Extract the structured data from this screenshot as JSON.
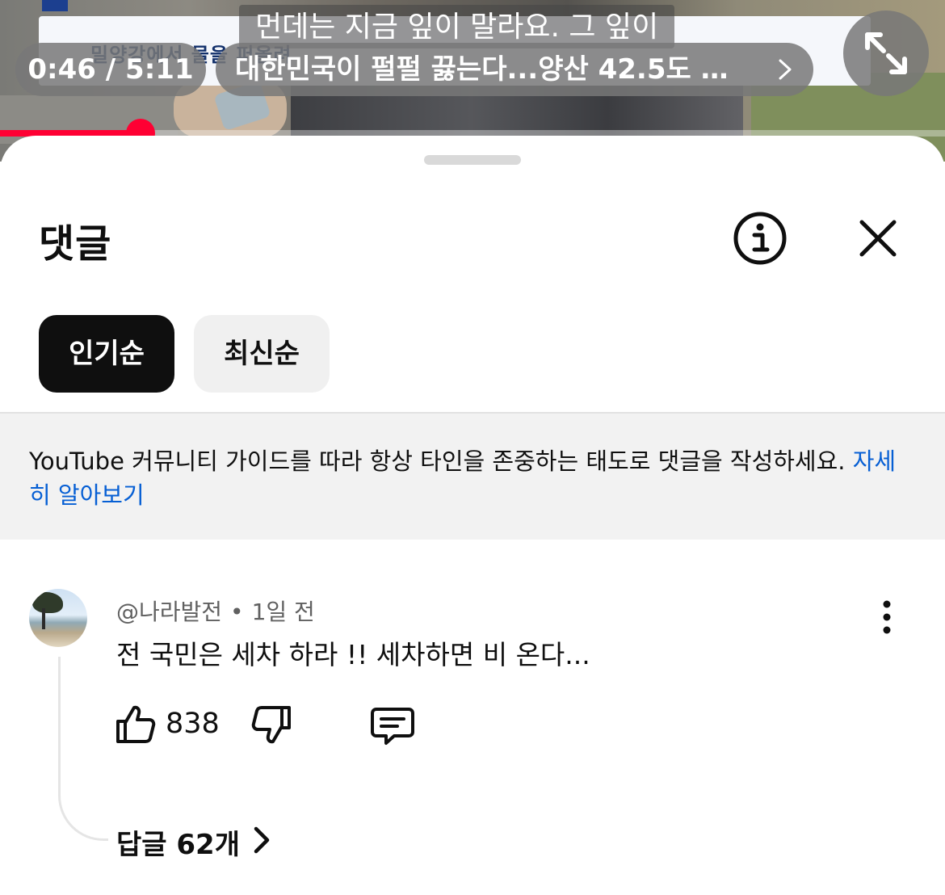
{
  "video": {
    "news_tag": "",
    "news_headline": "밀양강에서 물을 퍼올려",
    "subtitle": "먼데는 지금 잎이 말라요. 그 잎이",
    "time_display": "0:46 / 5:11",
    "title_chip": "대한민국이 펄펄 끓는다...양산 42.5도 역...",
    "progress_fraction": 0.149,
    "fullscreen_icon": "expand-arrows-icon"
  },
  "comments_panel": {
    "title": "댓글",
    "info_icon": "info-icon",
    "close_icon": "close-icon",
    "sort_chips": [
      "인기순",
      "최신순"
    ],
    "active_sort": "인기순",
    "guide_text": "YouTube 커뮤니티 가이드를 따라 항상 타인을 존중하는 태도로 댓글을 작성하세요.",
    "guide_link": "자세히 알아보기"
  },
  "comment": {
    "author": "@나라발전",
    "separator": "•",
    "time": "1일 전",
    "text": "전 국민은 세차 하라 !!  세차하면 비 온다...",
    "likes": "838",
    "replies_label": "답글 62개"
  },
  "colors": {
    "accent_red": "#ff0033",
    "link_blue": "#065fd4",
    "active_chip": "#0f0f0f",
    "inactive_chip": "#f0f0f0"
  }
}
